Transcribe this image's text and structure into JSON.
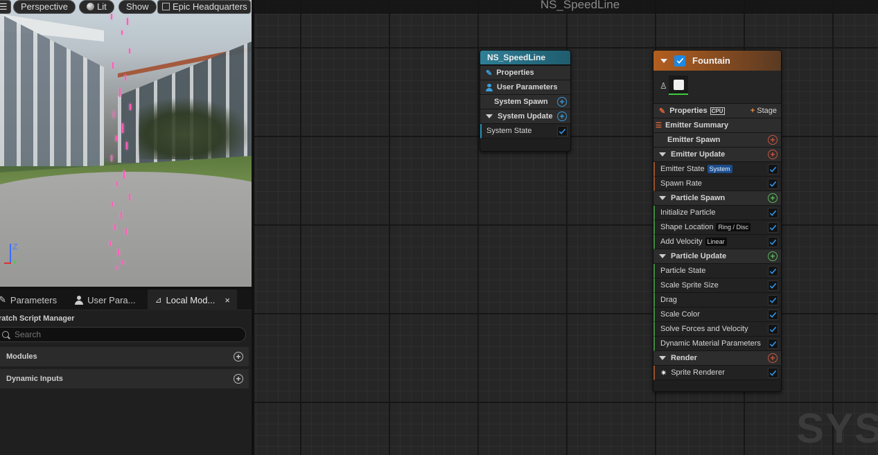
{
  "viewport": {
    "perspective_label": "Perspective",
    "lit_label": "Lit",
    "show_label": "Show",
    "headquarters_label": "Epic Headquarters",
    "axis_z": "Z",
    "axis_y": "Y"
  },
  "left_panel": {
    "tabs": [
      {
        "label": "Parameters"
      },
      {
        "label": "User Para..."
      },
      {
        "label": "Local Mod...",
        "close": "×"
      }
    ],
    "scratch_title": "ratch Script Manager",
    "search_placeholder": "Search",
    "sections": [
      {
        "label": "Modules"
      },
      {
        "label": "Dynamic Inputs"
      }
    ]
  },
  "graph": {
    "title": "NS_SpeedLine",
    "watermark": "SYS",
    "system_node": {
      "title": "NS_SpeedLine",
      "rows": {
        "properties": "Properties",
        "user_parameters": "User Parameters",
        "system_spawn": "System Spawn",
        "system_update": "System Update",
        "system_state": "System State"
      }
    },
    "emitter_node": {
      "title": "Fountain",
      "properties": "Properties",
      "cpu_tag": "CPU",
      "stage_label": "Stage",
      "emitter_summary": "Emitter Summary",
      "emitter_spawn": "Emitter Spawn",
      "emitter_update": "Emitter Update",
      "emitter_state": "Emitter State",
      "emitter_state_tag": "System",
      "spawn_rate": "Spawn Rate",
      "particle_spawn": "Particle Spawn",
      "initialize_particle": "Initialize Particle",
      "shape_location": "Shape Location",
      "shape_location_tag": "Ring / Disc",
      "add_velocity": "Add Velocity",
      "add_velocity_tag": "Linear",
      "particle_update": "Particle Update",
      "update_items": [
        "Particle State",
        "Scale Sprite Size",
        "Drag",
        "Scale Color",
        "Solve Forces and Velocity",
        "Dynamic Material Parameters"
      ],
      "render": "Render",
      "sprite_renderer": "Sprite Renderer"
    }
  },
  "colors": {
    "system_accent": "#2f7f96",
    "emitter_accent": "#b35e1f",
    "spawn_add": "#c8553d",
    "particle_add": "#5cb85c",
    "system_add": "#3a9ad9",
    "check_blue": "#1e88e5"
  }
}
